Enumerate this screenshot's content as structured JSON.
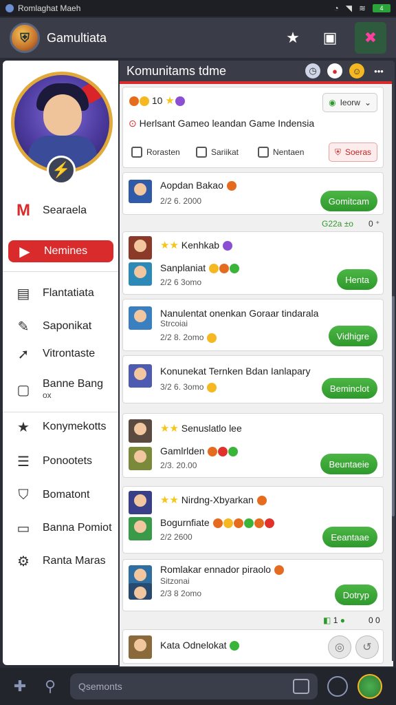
{
  "status": {
    "app_name": "Romlaghat Maeh"
  },
  "appbar": {
    "title": "Gamultiata"
  },
  "sidebar": {
    "items": [
      {
        "label": "Searaela",
        "icon": "brand-m-icon"
      },
      {
        "label": "Nemines",
        "icon": "tag-icon",
        "active": true
      },
      {
        "label": "Flantatiata",
        "icon": "document-icon"
      },
      {
        "label": "Saponikat",
        "icon": "pen-icon"
      },
      {
        "label": "Vitrontaste",
        "icon": "arrow-icon"
      },
      {
        "label": "Banne Bang",
        "sub": "ox",
        "icon": "card-icon"
      },
      {
        "label": "Konymekotts",
        "icon": "star-icon"
      },
      {
        "label": "Ponootets",
        "icon": "list-icon"
      },
      {
        "label": "Bomatont",
        "icon": "shirt-icon"
      },
      {
        "label": "Banna Pomiot",
        "icon": "screen-icon"
      },
      {
        "label": "Ranta Maras",
        "icon": "gear-icon"
      }
    ]
  },
  "main": {
    "header_title": "Komunitams tdme",
    "top_card": {
      "count": "10",
      "filter_label": "Ieorw",
      "description": "Herlsant Gameo leandan Game Indensia",
      "tabs": [
        "Rorasten",
        "Sariikat",
        "Nentaen"
      ],
      "red_button": "Soeras"
    },
    "meta_top": "G22a  ±o",
    "meta_top_right": "0  ⁺",
    "posts": [
      {
        "title": "Aopdan Bakao",
        "date": "2/2 6. 2000",
        "button": "Gomitcam"
      },
      {
        "title": "Kenhkab",
        "subtitle": "Sanplaniat",
        "date": "2/2 6 3omo",
        "button": "Henta"
      },
      {
        "title": "Nanulentat onenkan Goraar tindarala",
        "subtitle": "Strcoiai",
        "date": "2/2 8. 2omo",
        "button": "Vidhigre"
      },
      {
        "title": "Konunekat Ternken Bdan Ianlapary",
        "date": "3/2 6. 3omo",
        "button": "Beminclot"
      },
      {
        "title": "Senuslatlo lee",
        "subtitle": "Gamlrlden",
        "date": "2/3. 20.00",
        "button": "Beuntaeie"
      },
      {
        "title": "Nirdng‑Xbyarkan",
        "subtitle": "Bogurnfiate",
        "date": "2/2 2600",
        "button": "Eeantaae"
      },
      {
        "title": "Romlakar ennador piraolo",
        "subtitle": "Sitzonai",
        "date": "2/3 8 2omo",
        "button": "Dotryp"
      }
    ],
    "meta_bottom_left": "1",
    "meta_bottom_right": "0 0",
    "last_post": {
      "title": "Kata Odnelokat"
    }
  },
  "bottombar": {
    "search_placeholder": "Qsemonts"
  }
}
